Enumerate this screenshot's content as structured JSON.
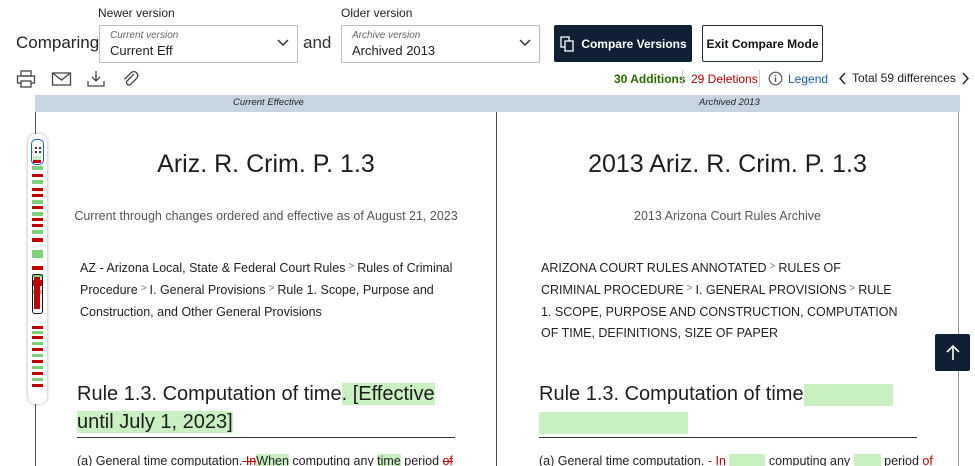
{
  "toolbar": {
    "comparing_label": "Comparing",
    "newer_label": "Newer version",
    "newer_select_sub": "Current version",
    "newer_select_value": "Current Eff",
    "and_label": "and",
    "older_label": "Older version",
    "older_select_sub": "Archive version",
    "older_select_value": "Archived 2013",
    "compare_button": "Compare Versions",
    "exit_button": "Exit Compare Mode",
    "tool_icons": [
      "print-icon",
      "email-icon",
      "download-icon",
      "attachment-icon"
    ]
  },
  "stats": {
    "additions": "30 Additions",
    "deletions": "29 Deletions",
    "legend": "Legend",
    "total": "Total 59 differences"
  },
  "columns": {
    "left_header": "Current Effective",
    "right_header": "Archived 2013"
  },
  "left_doc": {
    "title": "Ariz. R. Crim. P. 1.3",
    "subtitle": "Current through changes ordered and effective as of August 21, 2023",
    "crumbs": [
      "AZ - Arizona Local, State & Federal Court Rules",
      "Rules of Criminal Procedure",
      "I. General Provisions",
      "Rule 1. Scope, Purpose and Construction, and Other General Provisions"
    ],
    "rule_heading": "Rule 1.3. Computation of time",
    "rule_heading_added": "[Effective until July 1, 2023]",
    "body_start": "(a) General time computation.",
    "body_del": " In",
    "body_add": "When",
    "body_mid": " computing any ",
    "body_add2": "time",
    "body_end": " period ",
    "body_del2": "of"
  },
  "right_doc": {
    "title": "2013 Ariz. R. Crim. P. 1.3",
    "subtitle": "2013 Arizona Court Rules Archive",
    "crumbs": [
      "ARIZONA COURT RULES ANNOTATED",
      "RULES OF CRIMINAL PROCEDURE",
      "I. GENERAL PROVISIONS",
      "RULE 1. SCOPE, PURPOSE AND CONSTRUCTION, COMPUTATION OF TIME, DEFINITIONS, SIZE OF PAPER"
    ],
    "rule_heading": "Rule 1.3. Computation of time",
    "body_start": "(a) General time computation.",
    "body_del": " - In",
    "body_mid": "computing any",
    "body_end": "period",
    "body_del2": "of"
  },
  "colors": {
    "primary_dark": "#0f2034",
    "addition_green": "#2b6a00",
    "deletion_red": "#b10000",
    "highlight_green": "#c8f0c0",
    "header_strip": "#c7d4e2"
  }
}
